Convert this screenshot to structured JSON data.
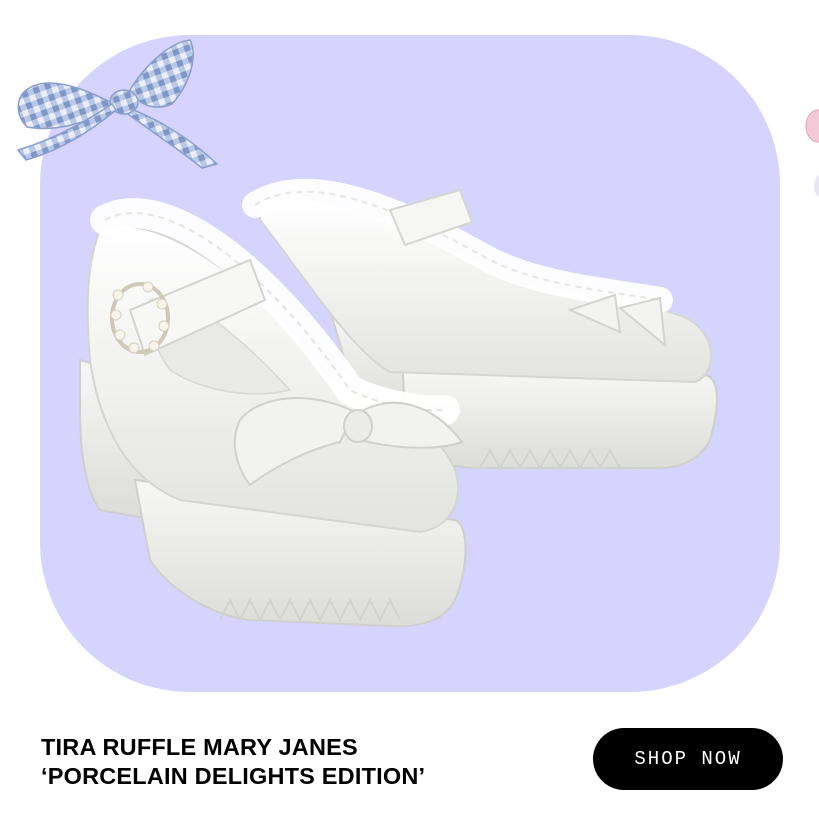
{
  "colors": {
    "panel": "#d6d3ff",
    "button_bg": "#000000",
    "button_text": "#ffffff",
    "bow": "#9fb2d8",
    "shoe": "#f4f4f2"
  },
  "product": {
    "title_line1": "TIRA RUFFLE MARY JANES",
    "title_line2": "‘PORCELAIN DELIGHTS EDITION’",
    "image_icon": "white-mary-jane-platform-shoes"
  },
  "decor": {
    "bow_icon": "gingham-bow-icon",
    "flower_icon": "pink-flower-icon"
  },
  "cta": {
    "label": "SHOP NOW"
  }
}
